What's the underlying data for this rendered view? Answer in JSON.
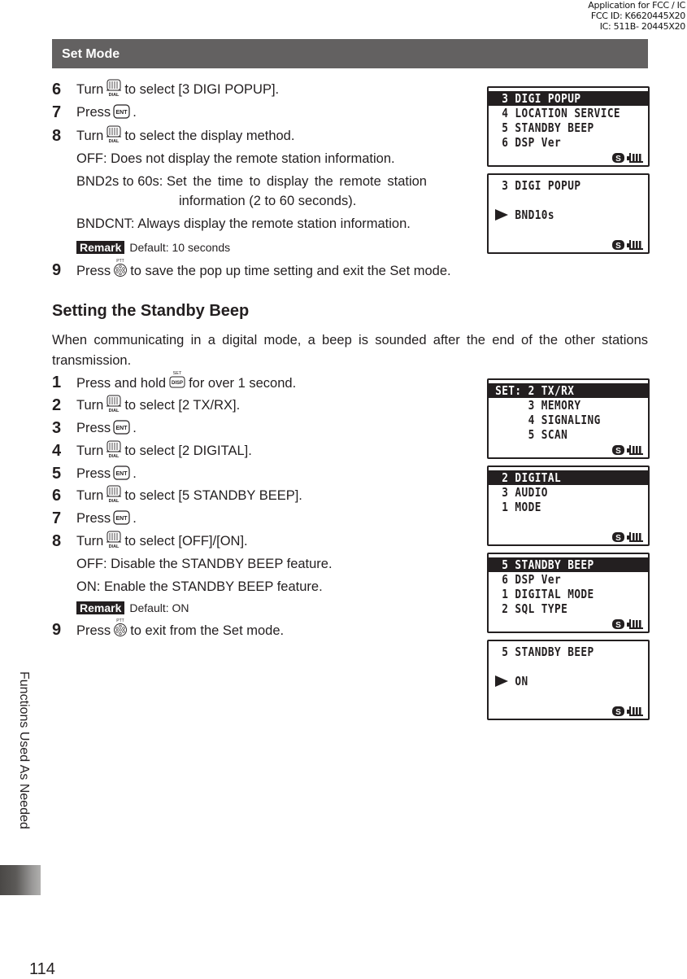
{
  "header": {
    "fcc_lines": [
      "Application for FCC / IC",
      "FCC ID: K6620445X20",
      "IC: 511B- 20445X20"
    ],
    "section_title": "Set Mode"
  },
  "icons": {
    "dial": "dial-knob-icon",
    "dial_caption": "DIAL",
    "ent": "ent-key-icon",
    "ent_caption": "ENT",
    "ptt": "ptt-button-icon",
    "ptt_caption": "PTT",
    "disp": "set-disp-key-icon",
    "disp_caption_top": "SET",
    "disp_caption": "DISP"
  },
  "popup": {
    "steps": [
      {
        "num": "6",
        "pre": "Turn",
        "icon": "dial",
        "post": "to select [3 DIGI POPUP]."
      },
      {
        "num": "7",
        "pre": "Press",
        "icon": "ent",
        "post": "."
      },
      {
        "num": "8",
        "pre": "Turn",
        "icon": "dial",
        "post": "to select the display method."
      },
      {
        "num": "9",
        "pre": "Press",
        "icon": "ptt",
        "post": "to save the pop up time setting and exit the Set mode."
      }
    ],
    "options": [
      {
        "label": "OFF:",
        "text": "Does not display the remote station information."
      },
      {
        "label": "BND2s to 60s:",
        "text": "Set  the  time  to  display  the  remote  station",
        "text2": "information (2 to 60 seconds)."
      },
      {
        "label": "BNDCNT:",
        "text": "Always display the remote station information."
      }
    ],
    "remark_tag": "Remark",
    "remark_text": "Default: 10 seconds"
  },
  "standby": {
    "heading": "Setting the Standby Beep",
    "intro": "When communicating in a digital mode, a beep is sounded after the end of the other stations transmission.",
    "steps": [
      {
        "num": "1",
        "pre": "Press and hold",
        "icon": "disp",
        "post": "for over 1 second."
      },
      {
        "num": "2",
        "pre": "Turn",
        "icon": "dial",
        "post": "to select [2 TX/RX]."
      },
      {
        "num": "3",
        "pre": "Press",
        "icon": "ent",
        "post": "."
      },
      {
        "num": "4",
        "pre": "Turn",
        "icon": "dial",
        "post": "to select [2 DIGITAL]."
      },
      {
        "num": "5",
        "pre": "Press",
        "icon": "ent",
        "post": "."
      },
      {
        "num": "6",
        "pre": "Turn",
        "icon": "dial",
        "post": "to select [5 STANDBY BEEP]."
      },
      {
        "num": "7",
        "pre": "Press",
        "icon": "ent",
        "post": "."
      },
      {
        "num": "8",
        "pre": "Turn",
        "icon": "dial",
        "post": "to select [OFF]/[ON]."
      },
      {
        "num": "9",
        "pre": "Press",
        "icon": "ptt",
        "post": "to exit from the Set mode."
      }
    ],
    "options": [
      {
        "label": "OFF:",
        "text": "Disable the STANDBY BEEP feature."
      },
      {
        "label": "ON:",
        "text": "Enable the STANDBY BEEP feature."
      }
    ],
    "remark_tag": "Remark",
    "remark_text": "Default: ON"
  },
  "screens": [
    {
      "rows": [
        {
          "text": "  3 DIGI POPUP",
          "hl": true
        },
        {
          "text": "  4 LOCATION SERVICE"
        },
        {
          "text": "  5 STANDBY BEEP"
        },
        {
          "text": "  6 DSP Ver"
        }
      ]
    },
    {
      "rows": [
        {
          "text": "  3 DIGI POPUP"
        },
        {
          "text": ""
        },
        {
          "text": "    BND10s",
          "arrow": true
        },
        {
          "text": ""
        }
      ]
    },
    {
      "rows": [
        {
          "text": " SET: 2 TX/RX",
          "hl": true
        },
        {
          "text": "      3 MEMORY"
        },
        {
          "text": "      4 SIGNALING"
        },
        {
          "text": "      5 SCAN"
        }
      ]
    },
    {
      "rows": [
        {
          "text": "  2 DIGITAL",
          "hl": true
        },
        {
          "text": "  3 AUDIO"
        },
        {
          "text": "  1 MODE"
        },
        {
          "text": ""
        }
      ]
    },
    {
      "rows": [
        {
          "text": "  5 STANDBY BEEP",
          "hl": true
        },
        {
          "text": "  6 DSP Ver"
        },
        {
          "text": "  1 DIGITAL MODE"
        },
        {
          "text": "  2 SQL TYPE"
        }
      ]
    },
    {
      "rows": [
        {
          "text": "  5 STANDBY BEEP"
        },
        {
          "text": ""
        },
        {
          "text": "    ON",
          "arrow": true
        },
        {
          "text": ""
        }
      ]
    }
  ],
  "screen_status": {
    "s_badge": "S",
    "battery": "battery-icon"
  },
  "footer": {
    "side_label": "Functions Used As Needed",
    "page_number": "114"
  }
}
